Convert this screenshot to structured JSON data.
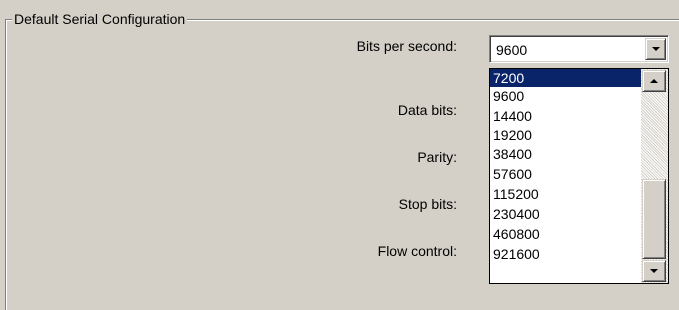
{
  "group": {
    "title": "Default Serial Configuration"
  },
  "labels": {
    "bits_per_second": "Bits per second:",
    "data_bits": "Data bits:",
    "parity": "Parity:",
    "stop_bits": "Stop bits:",
    "flow_control": "Flow control:"
  },
  "bits_per_second": {
    "value": "9600",
    "options": [
      "7200",
      "9600",
      "14400",
      "19200",
      "38400",
      "57600",
      "115200",
      "230400",
      "460800",
      "921600"
    ],
    "highlighted_option": "7200"
  },
  "icons": {
    "combo_button": "chevron-down-icon",
    "scroll_up": "scroll-up-icon",
    "scroll_down": "scroll-down-icon"
  },
  "colors": {
    "dialog_bg": "#d4d0c8",
    "selection_bg": "#0a246a",
    "selection_text": "#ffffff"
  }
}
